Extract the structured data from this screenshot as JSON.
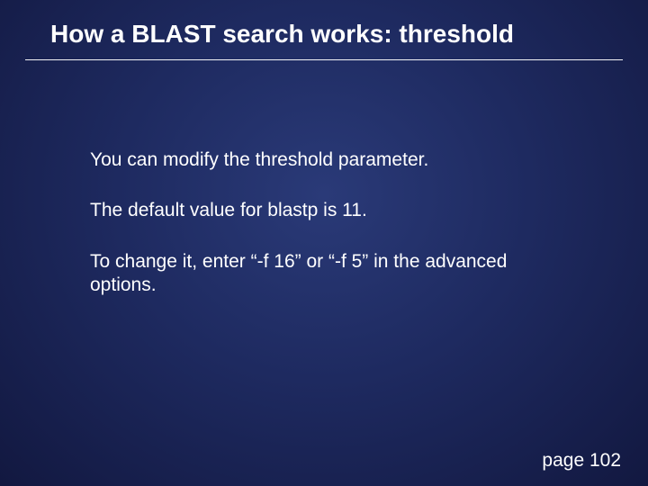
{
  "slide": {
    "title": "How a BLAST search works: threshold",
    "paragraphs": [
      "You can modify the threshold parameter.",
      "The default value for blastp is 11.",
      "To change it, enter “-f 16” or “-f 5” in the advanced options."
    ],
    "footer": "page 102"
  }
}
